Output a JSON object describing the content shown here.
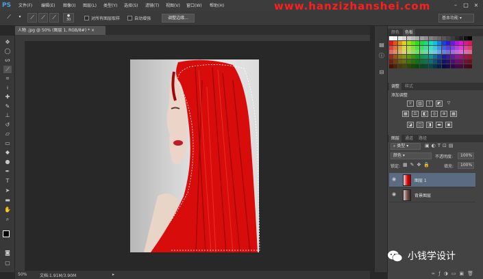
{
  "app": {
    "logo": "PS"
  },
  "menu": [
    "文件(F)",
    "编辑(E)",
    "图像(I)",
    "图层(L)",
    "类型(Y)",
    "选择(S)",
    "滤镜(T)",
    "视图(V)",
    "窗口(W)",
    "帮助(H)"
  ],
  "watermark_top": "www.hanzizhanshei.com",
  "options": {
    "brush_size": "30",
    "sample_all_layers": "对所有图层取样",
    "auto_enhance": "自动增强",
    "refine_edge": "调整边缘...",
    "workspace": "基本功能"
  },
  "document": {
    "tab_label": "人物 .jpg @ 50% (图层 1, RGB/8#) *",
    "zoom": "50%",
    "doc_size": "文档:1.91M/3.90M"
  },
  "panels": {
    "color_tabs": [
      "颜色",
      "色板"
    ],
    "adjust_tabs": [
      "调整",
      "样式"
    ],
    "adjust_title": "添加调整",
    "layers_tabs": [
      "图层",
      "通道",
      "路径"
    ],
    "filter_kind": "类型",
    "blend_mode": "颜色",
    "opacity_label": "不透明度:",
    "opacity": "100%",
    "lock_label": "锁定:",
    "fill_label": "填充:",
    "fill": "100%",
    "layers": [
      {
        "name": "图层 1",
        "selected": true
      },
      {
        "name": "背景图层",
        "selected": false
      }
    ]
  },
  "wechat_watermark": "小钱学设计",
  "colors": {
    "accent": "#4aa3df",
    "hair_red": "#e01010",
    "selected_layer": "#5b6b82"
  }
}
